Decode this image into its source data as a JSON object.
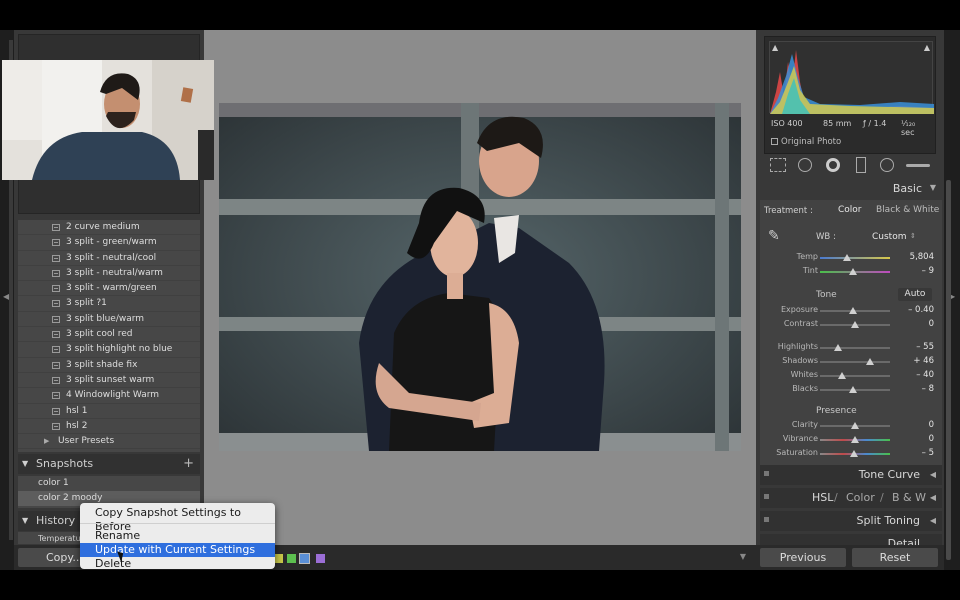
{
  "presets": [
    "2 curve medium",
    "3 split - green/warm",
    "3 split - neutral/cool",
    "3 split - neutral/warm",
    "3 split - warm/green",
    "3 split ?1",
    "3 split blue/warm",
    "3 split cool red",
    "3 split highlight no blue",
    "3 split shade fix",
    "3 split sunset warm",
    "4 Windowlight Warm",
    "hsl 1",
    "hsl 2"
  ],
  "user_presets": "User Presets",
  "snapshots": {
    "title": "Snapshots",
    "plus": "+",
    "items": [
      "color 1",
      "color 2 moody"
    ]
  },
  "history": {
    "title": "History",
    "peek": "Temperature"
  },
  "copy_button": "Copy...",
  "context_menu": {
    "items": [
      "Copy Snapshot Settings to Before",
      "Rename",
      "Update with Current Settings",
      "Delete"
    ],
    "highlighted": 2
  },
  "histogram": {
    "iso": "ISO 400",
    "focal": "85 mm",
    "aperture": "ƒ / 1.4",
    "shutter": "¹⁄₁₂₀ sec",
    "original_photo": "Original Photo"
  },
  "basic": {
    "title": "Basic",
    "treatment_label": "Treatment :",
    "treatment_color": "Color",
    "treatment_bw": "Black & White",
    "wb_label": "WB :",
    "wb_value": "Custom",
    "temp": {
      "label": "Temp",
      "value": "5,804",
      "pos": 0.38
    },
    "tint": {
      "label": "Tint",
      "value": "– 9",
      "pos": 0.47
    },
    "tone_label": "Tone",
    "auto_label": "Auto",
    "exposure": {
      "label": "Exposure",
      "value": "– 0.40",
      "pos": 0.47
    },
    "contrast": {
      "label": "Contrast",
      "value": "0",
      "pos": 0.5
    },
    "highlights": {
      "label": "Highlights",
      "value": "– 55",
      "pos": 0.25
    },
    "shadows": {
      "label": "Shadows",
      "value": "+ 46",
      "pos": 0.72
    },
    "whites": {
      "label": "Whites",
      "value": "– 40",
      "pos": 0.32
    },
    "blacks": {
      "label": "Blacks",
      "value": "– 8",
      "pos": 0.47
    },
    "presence_label": "Presence",
    "clarity": {
      "label": "Clarity",
      "value": "0",
      "pos": 0.5
    },
    "vibrance": {
      "label": "Vibrance",
      "value": "0",
      "pos": 0.5
    },
    "saturation": {
      "label": "Saturation",
      "value": "– 5",
      "pos": 0.48
    }
  },
  "panels": {
    "tone_curve": "Tone Curve",
    "hsl": "HSL",
    "color": "Color",
    "bw": "B & W",
    "split_toning": "Split Toning",
    "detail": "Detail"
  },
  "buttons": {
    "previous": "Previous",
    "reset": "Reset"
  },
  "colors": {
    "menu_highlight": "#2f6fde",
    "swatch_yellow": "#c8c84a",
    "swatch_green": "#5cbf4f",
    "swatch_blue": "#5a8fd6",
    "swatch_purple": "#9b6ed6"
  }
}
